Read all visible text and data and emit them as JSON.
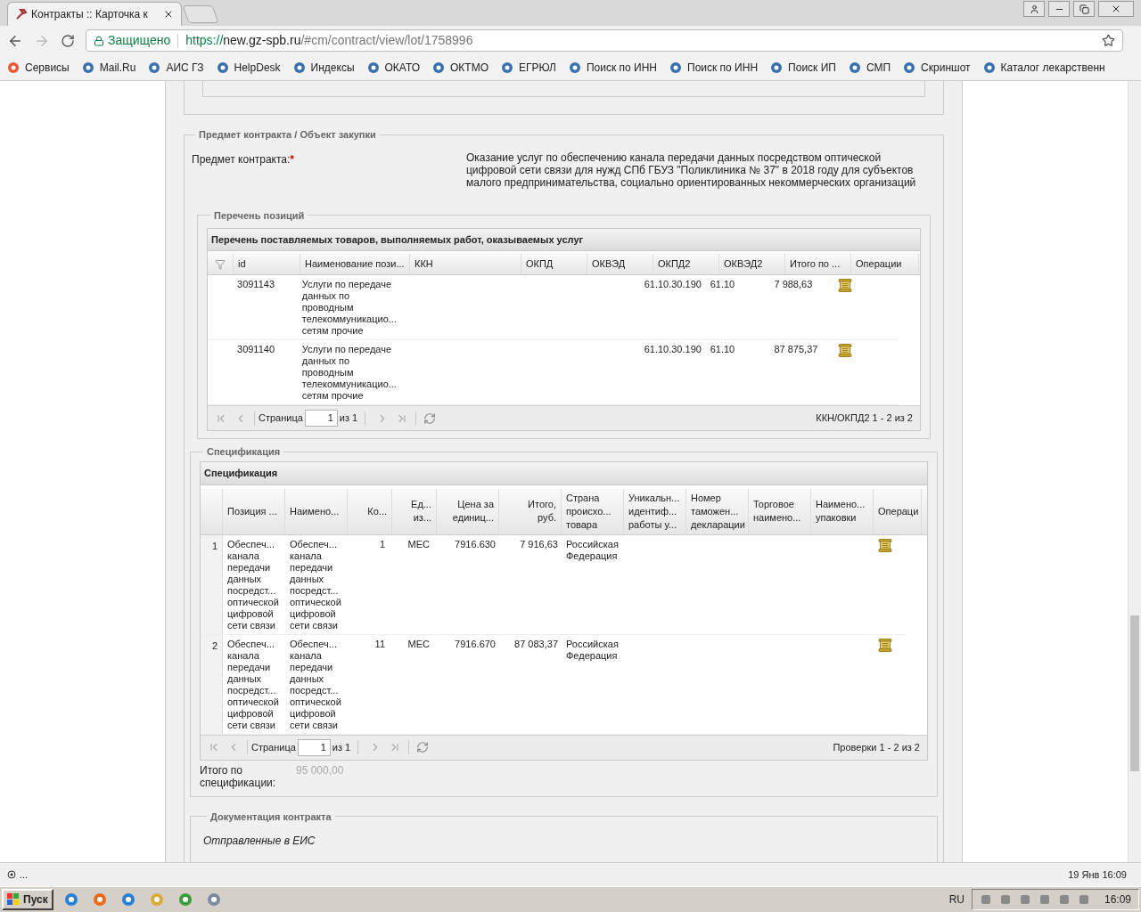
{
  "browser": {
    "tabs": [
      {
        "title": "Контракты :: Карточка к",
        "selected": true
      }
    ],
    "secure_label": "Защищено",
    "url": {
      "scheme": "https://",
      "host": "new.gz-spb.ru",
      "path": "/#cm/contract/view/lot/1758996"
    },
    "bookmarks": [
      {
        "label": "Сервисы"
      },
      {
        "label": "Mail.Ru"
      },
      {
        "label": "АИС ГЗ"
      },
      {
        "label": "HelpDesk"
      },
      {
        "label": "Индексы"
      },
      {
        "label": "ОКАТО"
      },
      {
        "label": "ОКТМО"
      },
      {
        "label": "ЕГРЮЛ"
      },
      {
        "label": "Поиск по ИНН"
      },
      {
        "label": "Поиск по ИНН"
      },
      {
        "label": "Поиск ИП"
      },
      {
        "label": "СМП"
      },
      {
        "label": "Скриншот"
      },
      {
        "label": "Каталог лекарственн"
      }
    ]
  },
  "page": {
    "subject": {
      "legend": "Предмет контракта / Объект закупки",
      "label": "Предмет контракта:",
      "required_mark": "*",
      "value": "Оказание услуг по обеспечению канала передачи данных посредством оптической\nцифровой сети связи для нужд СПб ГБУЗ \"Поликлиника № 37\" в 2018 году для субъектов\nмалого предпринимательства, социально ориентированных некоммерческих организаций"
    },
    "positions": {
      "legend": "Перечень позиций",
      "title": "Перечень поставляемых товаров, выполняемых работ, оказываемых услуг",
      "columns": [
        "id",
        "Наименование пози...",
        "ККН",
        "ОКПД",
        "ОКВЭД",
        "ОКПД2",
        "ОКВЭД2",
        "Итого по ...",
        "Операции"
      ],
      "rows": [
        {
          "cells": [
            "3091143",
            "Услуги по передаче\nданных по\nпроводным\nтелекоммуникацио...\nсетям прочие",
            null,
            null,
            null,
            "61.10.30.190",
            "61.10",
            "7 988,63"
          ]
        },
        {
          "cells": [
            "3091140",
            "Услуги по передаче\nданных по\nпроводным\nтелекоммуникацио...\nсетям прочие",
            null,
            null,
            null,
            "61.10.30.190",
            "61.10",
            "87 875,37"
          ]
        }
      ],
      "pager": {
        "page_label": "Страница",
        "page": "1",
        "of": "из 1",
        "summary": "ККН/ОКПД2 1 - 2 из 2"
      }
    },
    "specification": {
      "legend": "Спецификация",
      "title": "Спецификация",
      "columns": [
        "Позиция ...",
        "Наимено...",
        "Ко...",
        "Ед...\nиз...",
        "Цена за\nединиц...",
        "Итого,\nруб.",
        "Страна\nпроисхо...\nтовара",
        "Уникальн...\nидентиф...\nработы у...",
        "Номер\nтаможен...\nдекларации",
        "Торговое\nнаимено...",
        "Наимено...\nупаковки",
        "Операци"
      ],
      "rows": [
        {
          "num": "1",
          "cells": [
            "Обеспеч...\nканала\nпередачи\nданных\nпосредст...\nоптической\nцифровой\nсети связи",
            "Обеспеч...\nканала\nпередачи\nданных\nпосредст...\nоптической\nцифровой\nсети связи",
            "1",
            "МЕС",
            "7916.630",
            "7 916,63",
            "Российская\nФедерация"
          ]
        },
        {
          "num": "2",
          "cells": [
            "Обеспеч...\nканала\nпередачи\nданных\nпосредст...\nоптической\nцифровой\nсети связи",
            "Обеспеч...\nканала\nпередачи\nданных\nпосредст...\nоптической\nцифровой\nсети связи",
            "11",
            "МЕС",
            "7916.670",
            "87 083,37",
            "Российская\nФедерация"
          ]
        }
      ],
      "pager": {
        "page_label": "Страница",
        "page": "1",
        "of": "из 1",
        "summary": "Проверки 1 - 2 из 2"
      },
      "total_label": "Итого по\nспецификации:",
      "total_value": "95 000,00"
    },
    "documentation": {
      "legend": "Документация контракта",
      "subtitle": "Отправленные в ЕИС"
    }
  },
  "status_bar": {
    "left": "...",
    "right": "19 Янв 16:09"
  },
  "taskbar": {
    "start": "Пуск",
    "language": "RU",
    "clock": "16:09"
  }
}
